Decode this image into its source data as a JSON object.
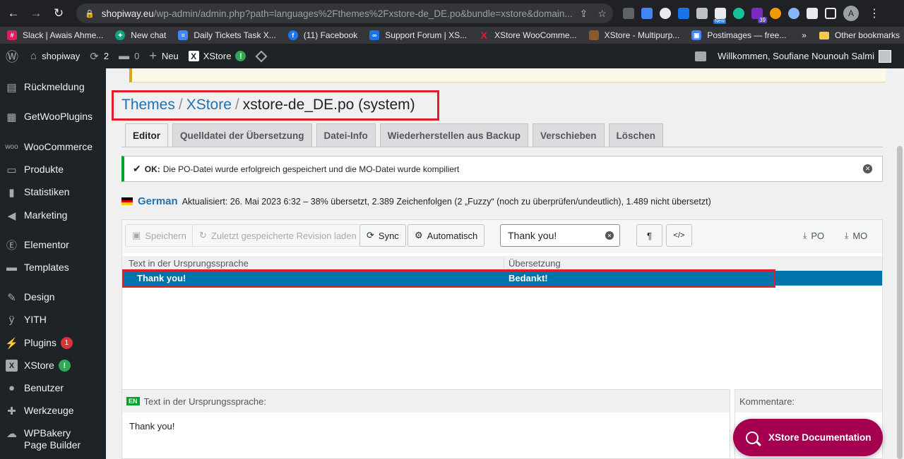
{
  "browser": {
    "url_host": "shopiway.eu",
    "url_path": "/wp-admin/admin.php?path=languages%2Fthemes%2Fxstore-de_DE.po&bundle=xstore&domain...",
    "ext_new_badge": "New",
    "ext_count_badge": "39",
    "profile_initial": "A"
  },
  "bookmarks": {
    "items": [
      {
        "label": "Slack | Awais Ahme...",
        "color": "#4a154b"
      },
      {
        "label": "New chat",
        "color": "#10a37f"
      },
      {
        "label": "Daily Tickets Task X...",
        "color": "#4285f4"
      },
      {
        "label": "(11) Facebook",
        "color": "#1877f2"
      },
      {
        "label": "Support Forum | XS...",
        "color": "#1a73e8"
      },
      {
        "label": "XStore WooComme...",
        "color": "#e01e2b"
      },
      {
        "label": "XStore - Multipurp...",
        "color": "#8b5a2b"
      },
      {
        "label": "Postimages — free...",
        "color": "#4285f4"
      }
    ],
    "overflow": "»",
    "other": "Other bookmarks"
  },
  "adminbar": {
    "site": "shopiway",
    "updates": "2",
    "comments": "0",
    "new_label": "Neu",
    "xstore_label": "XStore",
    "greeting": "Willkommen, Soufiane Nounouh Salmi"
  },
  "sidebar": {
    "items": [
      {
        "label": "Rückmeldung"
      },
      {
        "label": "GetWooPlugins"
      },
      {
        "label": "WooCommerce"
      },
      {
        "label": "Produkte"
      },
      {
        "label": "Statistiken"
      },
      {
        "label": "Marketing"
      },
      {
        "label": "Elementor"
      },
      {
        "label": "Templates"
      },
      {
        "label": "Design"
      },
      {
        "label": "YITH"
      },
      {
        "label": "Plugins",
        "badge": "1"
      },
      {
        "label": "XStore",
        "badge": "!"
      },
      {
        "label": "Benutzer"
      },
      {
        "label": "Werkzeuge"
      },
      {
        "label": "WPBakery Page Builder"
      }
    ]
  },
  "page": {
    "crumb1": "Themes",
    "crumb2": "XStore",
    "crumb3": "xstore-de_DE.po (system)",
    "sep": "/"
  },
  "tabs": [
    {
      "label": "Editor"
    },
    {
      "label": "Quelldatei der Übersetzung"
    },
    {
      "label": "Datei-Info"
    },
    {
      "label": "Wiederherstellen aus Backup"
    },
    {
      "label": "Verschieben"
    },
    {
      "label": "Löschen"
    }
  ],
  "notice": {
    "ok_label": "OK:",
    "message": "Die PO-Datei wurde erfolgreich gespeichert und die MO-Datei wurde kompiliert"
  },
  "language": {
    "name": "German",
    "status": "Aktualisiert: 26. Mai 2023 6:32 – 38% übersetzt, 2.389 Zeichenfolgen (2 „Fuzzy“ (noch zu überprüfen/undeutlich), 1.489 nicht übersetzt)"
  },
  "toolbar": {
    "save": "Speichern",
    "revert": "Zuletzt gespeicherte Revision laden",
    "sync": "Sync",
    "auto": "Automatisch",
    "search_value": "Thank you!",
    "pilcrow": "¶",
    "code": "</>",
    "po": "PO",
    "mo": "MO"
  },
  "table": {
    "col_source": "Text in der Ursprungssprache",
    "col_translation": "Übersetzung",
    "rows": [
      {
        "source": "Thank you!",
        "translation": "Bedankt!"
      }
    ]
  },
  "source_pane": {
    "tag": "EN",
    "label": "Text in der Ursprungssprache:",
    "text": "Thank you!"
  },
  "comments_pane": {
    "label": "Kommentare:"
  },
  "doc_button": {
    "label": "XStore Documentation"
  }
}
